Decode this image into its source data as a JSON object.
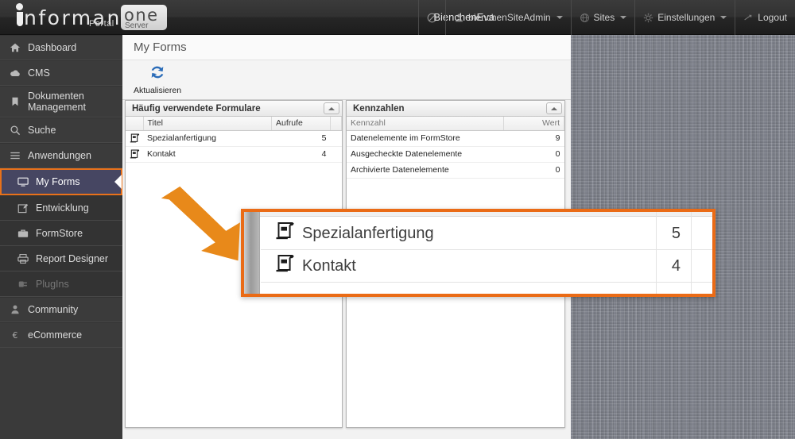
{
  "brand": {
    "word": "nformance",
    "portal": "Portal",
    "one": "one",
    "server": "Server"
  },
  "topbar": {
    "user_name": "BienchenEva",
    "accent_color": "#e8711a",
    "items": [
      {
        "icon": "block-icon",
        "label": "",
        "caret": false
      },
      {
        "icon": "user-icon",
        "label": "bienchenSiteAdmin",
        "caret": true
      },
      {
        "icon": "globe-icon",
        "label": "Sites",
        "caret": true
      },
      {
        "icon": "gear-icon",
        "label": "Einstellungen",
        "caret": true
      },
      {
        "icon": "logout-icon",
        "label": "Logout",
        "caret": false
      }
    ]
  },
  "sidebar": {
    "items": [
      {
        "label": "Dashboard",
        "icon": "home-icon",
        "style": "normal"
      },
      {
        "label": "CMS",
        "icon": "cloud-icon",
        "style": "normal"
      },
      {
        "label": "Dokumenten Management",
        "icon": "bookmark-icon",
        "style": "two-line"
      },
      {
        "label": "Suche",
        "icon": "search-icon",
        "style": "normal"
      },
      {
        "label": "Anwendungen",
        "icon": "menu-icon",
        "style": "section"
      },
      {
        "label": "My Forms",
        "icon": "monitor-icon",
        "style": "selected"
      },
      {
        "label": "Entwicklung",
        "icon": "pencil-square-icon",
        "style": "sub"
      },
      {
        "label": "FormStore",
        "icon": "briefcase-icon",
        "style": "sub"
      },
      {
        "label": "Report Designer",
        "icon": "printer-icon",
        "style": "sub"
      },
      {
        "label": "PlugIns",
        "icon": "plug-icon",
        "style": "sub-dim"
      },
      {
        "label": "Community",
        "icon": "person-icon",
        "style": "normal"
      },
      {
        "label": "eCommerce",
        "icon": "euro-icon",
        "style": "normal"
      }
    ]
  },
  "content": {
    "title": "My Forms",
    "toolbar": {
      "refresh_label": "Aktualisieren",
      "refresh_icon": "refresh-icon"
    }
  },
  "panel_forms": {
    "title": "Häufig verwendete Formulare",
    "collapse_icon": "chevron-up-icon",
    "columns": [
      "Titel",
      "Aufrufe"
    ],
    "rows": [
      {
        "icon": "form-icon",
        "title": "Spezialanfertigung",
        "count": "5"
      },
      {
        "icon": "form-icon",
        "title": "Kontakt",
        "count": "4"
      }
    ]
  },
  "panel_kpi": {
    "title": "Kennzahlen",
    "collapse_icon": "chevron-up-icon",
    "columns": [
      "Kennzahl",
      "Wert"
    ],
    "rows": [
      {
        "label": "Datenelemente im FormStore",
        "value": "9"
      },
      {
        "label": "Ausgecheckte Datenelemente",
        "value": "0"
      },
      {
        "label": "Archivierte Datenelemente",
        "value": "0"
      }
    ]
  },
  "callout": {
    "border_color": "#ea6b16",
    "rows": [
      {
        "icon": "form-icon",
        "title": "Spezialanfertigung",
        "count": "5"
      },
      {
        "icon": "form-icon",
        "title": "Kontakt",
        "count": "4"
      }
    ]
  },
  "annotation": {
    "arrow_icon": "arrow-down-right-icon",
    "arrow_color": "#e8891a"
  }
}
